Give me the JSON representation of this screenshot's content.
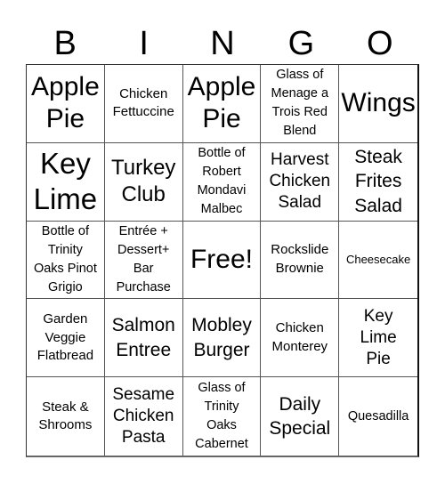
{
  "header": {
    "letters": [
      "B",
      "I",
      "N",
      "G",
      "O"
    ]
  },
  "cells": [
    "Apple\nPie",
    "Chicken\nFettuccine",
    "Apple\nPie",
    "Glass of\nMenage a\nTrois Red\nBlend",
    "Wings",
    "Key\nLime",
    "Turkey\nClub",
    "Bottle of\nRobert\nMondavi\nMalbec",
    "Harvest\nChicken\nSalad",
    "Steak\nFrites\nSalad",
    "Bottle of\nTrinity\nOaks Pinot\nGrigio",
    "Entrée +\nDessert+\nBar\nPurchase",
    "Free!",
    "Rockslide\nBrownie",
    "Cheesecake",
    "Garden\nVeggie\nFlatbread",
    "Salmon\nEntree",
    "Mobley\nBurger",
    "Chicken\nMonterey",
    "Key\nLime\nPie",
    "Steak &\nShrooms",
    "Sesame\nChicken\nPasta",
    "Glass of\nTrinity\nOaks\nCabernet",
    "Daily\nSpecial",
    "Quesadilla"
  ]
}
